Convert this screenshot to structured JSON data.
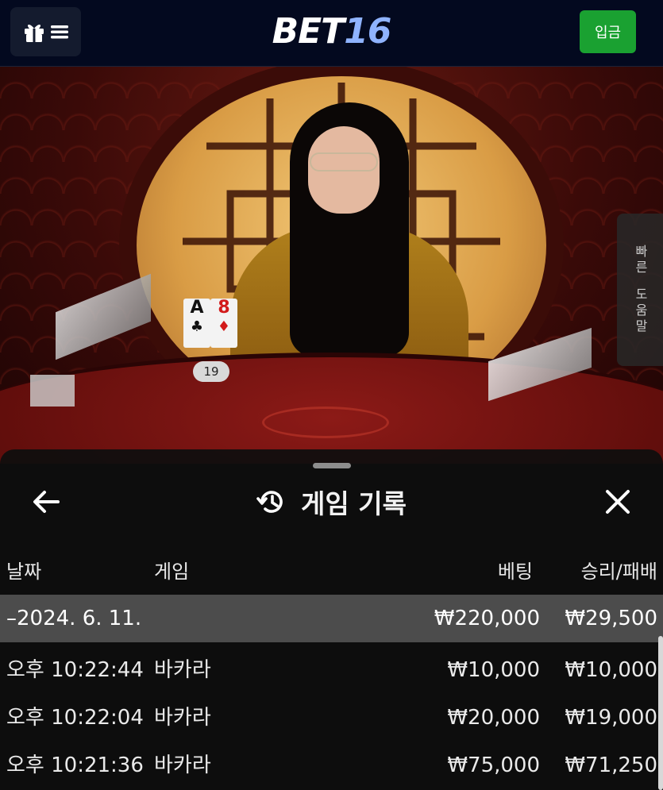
{
  "header": {
    "logo_main": "BET",
    "logo_num": "16",
    "login_label": "입금"
  },
  "video": {
    "player_cards": [
      "A",
      "8"
    ],
    "player_score": "19",
    "side_help": [
      "빠른",
      "도움말"
    ]
  },
  "panel": {
    "title": "게임 기록",
    "columns": {
      "date": "날짜",
      "game": "게임",
      "bet": "베팅",
      "result": "승리/패배"
    },
    "summary": {
      "date": "–2024. 6. 11.",
      "bet": "₩220,000",
      "result": "₩29,500"
    },
    "rows": [
      {
        "time": "오후 10:22:44",
        "game": "바카라",
        "bet": "₩10,000",
        "result": "₩10,000"
      },
      {
        "time": "오후 10:22:04",
        "game": "바카라",
        "bet": "₩20,000",
        "result": "₩19,000"
      },
      {
        "time": "오후 10:21:36",
        "game": "바카라",
        "bet": "₩75,000",
        "result": "₩71,250"
      }
    ]
  }
}
